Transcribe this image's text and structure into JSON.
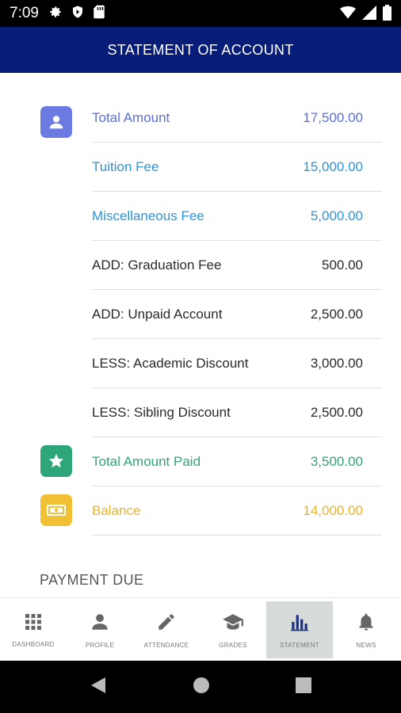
{
  "status_bar": {
    "time": "7:09",
    "icons_left": [
      "gear-icon",
      "shield-play-icon",
      "sd-card-icon"
    ],
    "icons_right": [
      "wifi-icon",
      "cell-signal-icon",
      "battery-icon"
    ]
  },
  "app_bar": {
    "title": "STATEMENT OF ACCOUNT"
  },
  "colors": {
    "app_bar": "#071d78",
    "total_amount": "#5b6fd8",
    "fees": "#2c94d6",
    "paid": "#2fa67a",
    "balance": "#eab32c"
  },
  "statement": {
    "rows": [
      {
        "label": "Total Amount",
        "value": "17,500.00",
        "icon": "person-icon"
      },
      {
        "label": "Tuition Fee",
        "value": "15,000.00"
      },
      {
        "label": "Miscellaneous Fee",
        "value": "5,000.00"
      },
      {
        "label": "ADD: Graduation Fee",
        "value": "500.00"
      },
      {
        "label": "ADD: Unpaid Account",
        "value": "2,500.00"
      },
      {
        "label": "LESS: Academic Discount",
        "value": "3,000.00"
      },
      {
        "label": "LESS: Sibling Discount",
        "value": "2,500.00"
      },
      {
        "label": "Total Amount Paid",
        "value": "3,500.00",
        "icon": "star-icon"
      },
      {
        "label": "Balance",
        "value": "14,000.00",
        "icon": "money-icon"
      }
    ]
  },
  "payment_due": {
    "title": "PAYMENT DUE"
  },
  "bottom_nav": {
    "items": [
      {
        "label": "DASHBOARD",
        "icon": "grid-icon"
      },
      {
        "label": "PROFILE",
        "icon": "person-icon"
      },
      {
        "label": "ATTENDANCE",
        "icon": "pencil-icon"
      },
      {
        "label": "GRADES",
        "icon": "graduation-cap-icon"
      },
      {
        "label": "STATEMENT",
        "icon": "bar-chart-icon",
        "active": true
      },
      {
        "label": "NEWS",
        "icon": "bell-icon"
      }
    ]
  },
  "system_nav": {
    "icons": [
      "back-icon",
      "home-icon",
      "recents-icon"
    ]
  }
}
